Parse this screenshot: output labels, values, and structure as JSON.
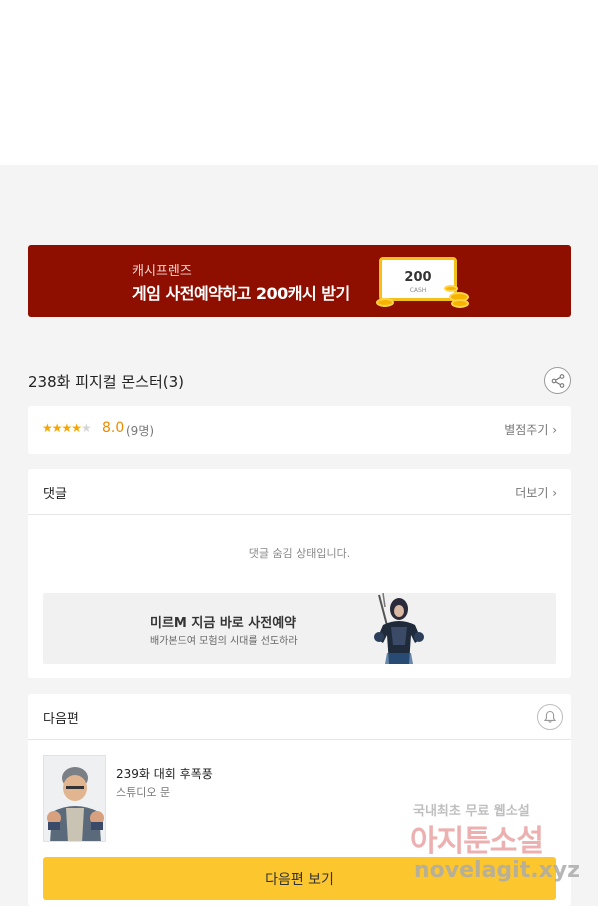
{
  "promo": {
    "sub": "캐시프렌즈",
    "main": "게임 사전예약하고 200캐시 받기",
    "ticket_amount": "200",
    "ticket_unit": "CASH",
    "bg_color": "#8e0e00"
  },
  "episode": {
    "title": "238화 피지컬 몬스터(3)"
  },
  "rating": {
    "stars_on": "★★★★",
    "stars_off": "★",
    "score": "8.0",
    "count": "(9명)",
    "rate_link": "별점주기 ›",
    "star_color": "#f7a600"
  },
  "comments": {
    "title": "댓글",
    "more": "더보기 ›",
    "hidden_message": "댓글 숨김 상태입니다."
  },
  "ad": {
    "title": "미르M 지금 바로 사전예약",
    "desc": "배가본드여 모험의 시대를 선도하라"
  },
  "next_episode": {
    "header": "다음편",
    "title": "239화 대회 후폭풍",
    "author": "스튜디오 문",
    "button": "다음편 보기",
    "button_color": "#fcc62f"
  },
  "watermark": {
    "line1": "국내최초 무료 웹소설",
    "line2": "아지툰소설",
    "line3": "novelagit.xyz"
  },
  "icons": {
    "share": "share-icon",
    "bell": "bell-icon"
  }
}
